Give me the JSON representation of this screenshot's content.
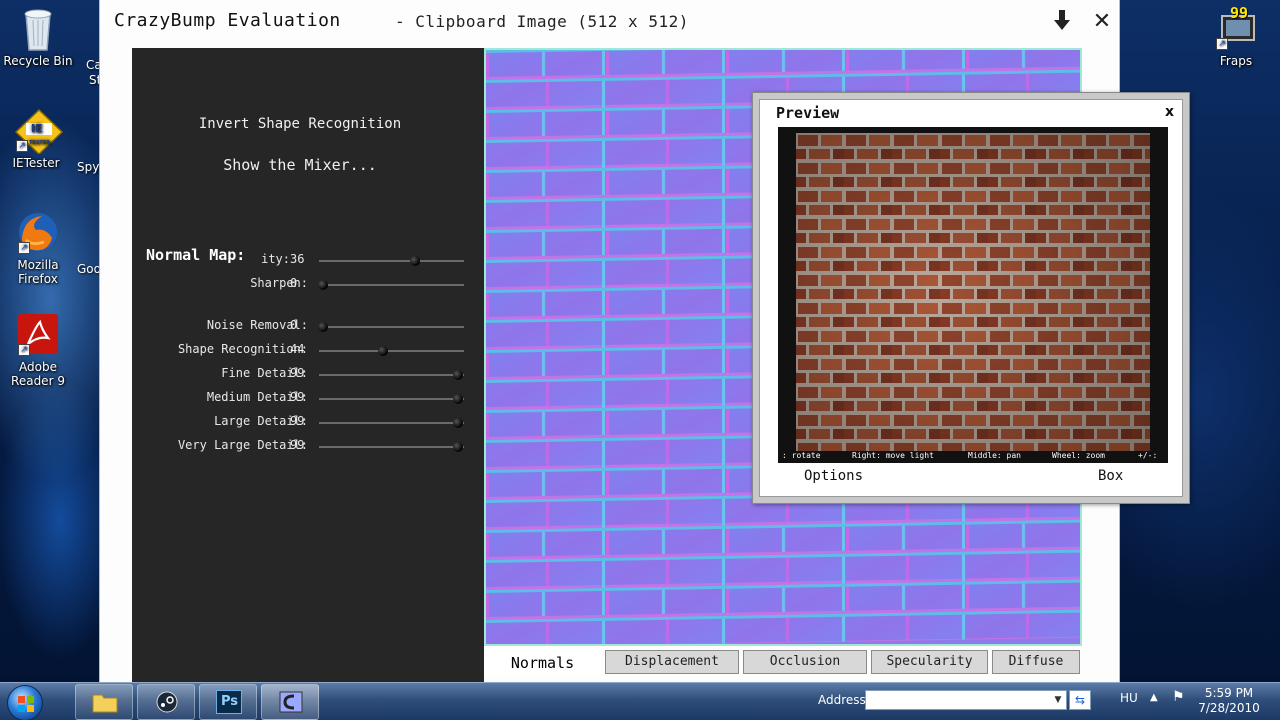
{
  "desktop": {
    "icons": [
      {
        "label": "Recycle Bin"
      },
      {
        "label": "IETester"
      },
      {
        "label": "Mozilla Firefox"
      },
      {
        "label": "Adobe Reader 9"
      },
      {
        "label": "Fraps"
      }
    ],
    "ie_badge": "IE",
    "ie_badge_small": "TESTER",
    "fraps_counter": "99",
    "partial_labels": [
      "Ca",
      "St",
      "Spy",
      "Goo"
    ]
  },
  "window": {
    "title": "CrazyBump Evaluation",
    "subtitle": "- Clipboard Image (512 x 512)"
  },
  "left_panel": {
    "invert_label": "Invert Shape Recognition",
    "mixer_label": "Show the Mixer...",
    "normal_map_title": "Normal Map:",
    "sliders": [
      {
        "label": "ity:",
        "value": 36,
        "fraction": 0.66
      },
      {
        "label": "Sharpen:",
        "value": 0,
        "fraction": 0.03
      },
      {
        "label": "Noise Removal:",
        "value": 0,
        "fraction": 0.03
      },
      {
        "label": "Shape Recognition:",
        "value": 44,
        "fraction": 0.44
      },
      {
        "label": "Fine Detail:",
        "value": 99,
        "fraction": 0.96
      },
      {
        "label": "Medium Detail:",
        "value": 99,
        "fraction": 0.96
      },
      {
        "label": "Large Detail:",
        "value": 99,
        "fraction": 0.96
      },
      {
        "label": "Very Large Detail:",
        "value": 99,
        "fraction": 0.96
      }
    ]
  },
  "tabs": [
    {
      "label": "Normals",
      "active": true
    },
    {
      "label": "Displacement",
      "active": false
    },
    {
      "label": "Occlusion",
      "active": false
    },
    {
      "label": "Specularity",
      "active": false
    },
    {
      "label": "Diffuse",
      "active": false
    }
  ],
  "preview": {
    "title": "Preview",
    "close": "x",
    "hints": {
      "rotate": ": rotate",
      "move_light": "Right: move light",
      "pan": "Middle: pan",
      "zoom": "Wheel: zoom",
      "plusminus": "+/-:"
    },
    "options_label": "Options",
    "box_label": "Box"
  },
  "taskbar": {
    "address_label": "Address",
    "address_value": "",
    "language": "HU",
    "time": "5:59 PM",
    "date": "7/28/2010",
    "ps_label": "Ps"
  },
  "colors": {
    "normal_map_base": "#8a7ee8",
    "panel_bg": "#262626",
    "accent": "#9fe8d8"
  }
}
